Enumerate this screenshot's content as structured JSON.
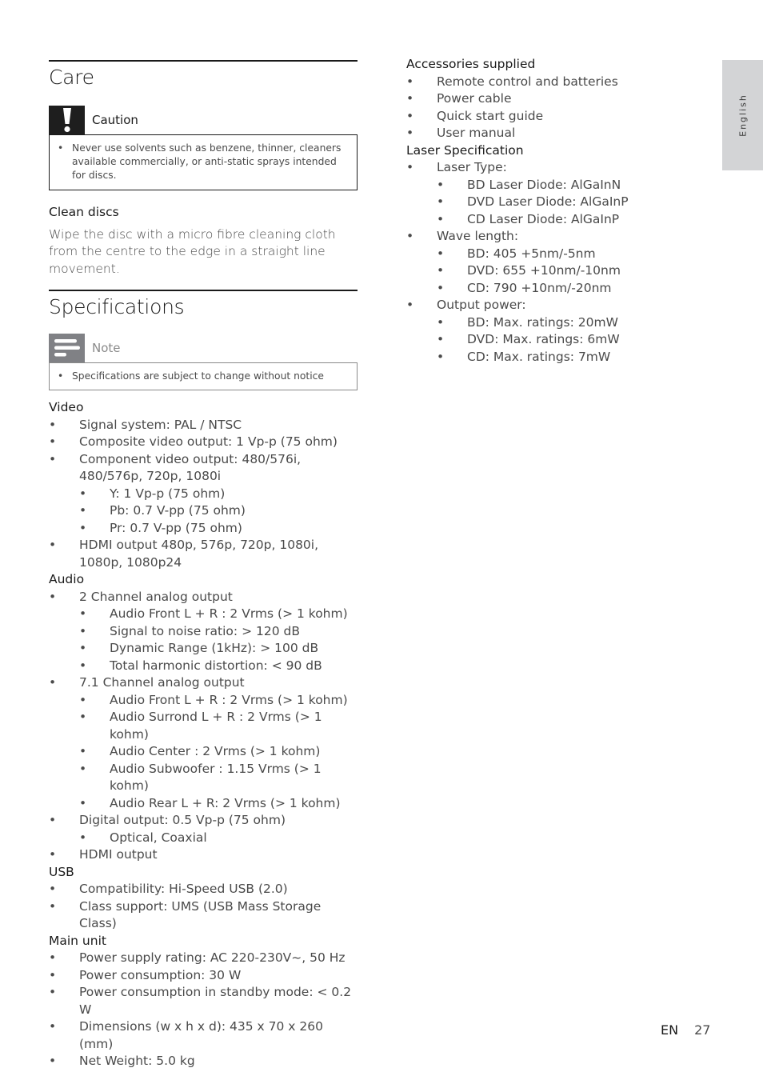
{
  "care": {
    "title": "Care",
    "caution": {
      "icon": "exclamation-icon",
      "label": "Caution",
      "items": [
        "Never use solvents such as benzene, thinner, cleaners available commercially, or anti-static sprays intended for discs."
      ]
    },
    "clean_discs": {
      "heading": "Clean discs",
      "text": "Wipe the disc with a micro fibre cleaning cloth from the centre to the edge in a straight line movement."
    }
  },
  "specifications": {
    "title": "Specifications",
    "note": {
      "icon": "note-lines-icon",
      "label": "Note",
      "items": [
        "Specifications are subject to change without notice"
      ]
    },
    "sections": [
      {
        "heading": "Video",
        "items": [
          {
            "text": "Signal system: PAL / NTSC",
            "level": 1
          },
          {
            "text": "Composite video output: 1 Vp-p (75 ohm)",
            "level": 1
          },
          {
            "text": "Component video output: 480/576i, 480/576p, 720p, 1080i",
            "level": 1
          },
          {
            "text": "Y: 1 Vp-p (75 ohm)",
            "level": 2
          },
          {
            "text": "Pb: 0.7 V-pp (75 ohm)",
            "level": 2
          },
          {
            "text": "Pr: 0.7 V-pp (75 ohm)",
            "level": 2
          },
          {
            "text": "HDMI output 480p, 576p, 720p, 1080i, 1080p, 1080p24",
            "level": 1
          }
        ]
      },
      {
        "heading": "Audio",
        "items": [
          {
            "text": "2 Channel analog output",
            "level": 1
          },
          {
            "text": "Audio Front L + R : 2 Vrms (> 1 kohm)",
            "level": 2
          },
          {
            "text": "Signal to noise ratio: > 120 dB",
            "level": 2
          },
          {
            "text": "Dynamic Range (1kHz): > 100 dB",
            "level": 2
          },
          {
            "text": "Total harmonic distortion: < 90 dB",
            "level": 2
          },
          {
            "text": "7.1 Channel analog output",
            "level": 1
          },
          {
            "text": "Audio Front L + R : 2 Vrms (> 1 kohm)",
            "level": 2
          },
          {
            "text": "Audio Surrond L + R : 2 Vrms (> 1 kohm)",
            "level": 2
          },
          {
            "text": "Audio Center : 2 Vrms (> 1 kohm)",
            "level": 2
          },
          {
            "text": "Audio Subwoofer : 1.15 Vrms (> 1 kohm)",
            "level": 2
          },
          {
            "text": "Audio Rear L + R: 2 Vrms (> 1 kohm)",
            "level": 2
          },
          {
            "text": "Digital output: 0.5 Vp-p (75 ohm)",
            "level": 1
          },
          {
            "text": "Optical, Coaxial",
            "level": 2
          },
          {
            "text": "HDMI output",
            "level": 1
          }
        ]
      },
      {
        "heading": "USB",
        "items": [
          {
            "text": "Compatibility: Hi-Speed USB (2.0)",
            "level": 1
          },
          {
            "text": "Class support: UMS (USB Mass Storage Class)",
            "level": 1
          }
        ]
      },
      {
        "heading": "Main unit",
        "items": [
          {
            "text": "Power supply rating: AC 220-230V~, 50 Hz",
            "level": 1
          },
          {
            "text": "Power consumption: 30 W",
            "level": 1
          },
          {
            "text": "Power consumption in standby mode: < 0.2 W",
            "level": 1
          },
          {
            "text": "Dimensions (w x h x d): 435 x 70 x 260 (mm)",
            "level": 1
          },
          {
            "text": "Net Weight: 5.0 kg",
            "level": 1
          }
        ]
      }
    ],
    "right_sections": [
      {
        "heading": "Accessories supplied",
        "items": [
          {
            "text": "Remote control and batteries",
            "level": 1
          },
          {
            "text": "Power cable",
            "level": 1
          },
          {
            "text": "Quick start guide",
            "level": 1
          },
          {
            "text": "User manual",
            "level": 1
          }
        ]
      },
      {
        "heading": "Laser Specification",
        "items": [
          {
            "text": "Laser Type:",
            "level": 1
          },
          {
            "text": "BD Laser Diode: AlGaInN",
            "level": 2
          },
          {
            "text": "DVD Laser Diode: AlGaInP",
            "level": 2
          },
          {
            "text": "CD Laser Diode: AlGaInP",
            "level": 2
          },
          {
            "text": "Wave length:",
            "level": 1
          },
          {
            "text": "BD: 405 +5nm/-5nm",
            "level": 2
          },
          {
            "text": "DVD: 655 +10nm/-10nm",
            "level": 2
          },
          {
            "text": "CD: 790 +10nm/-20nm",
            "level": 2
          },
          {
            "text": "Output power:",
            "level": 1
          },
          {
            "text": "BD: Max. ratings: 20mW",
            "level": 2
          },
          {
            "text": "DVD: Max. ratings: 6mW",
            "level": 2
          },
          {
            "text": "CD: Max. ratings: 7mW",
            "level": 2
          }
        ]
      }
    ]
  },
  "side_tab": {
    "label": "English"
  },
  "footer": {
    "lang": "EN",
    "page": "27"
  },
  "bullet": "•"
}
